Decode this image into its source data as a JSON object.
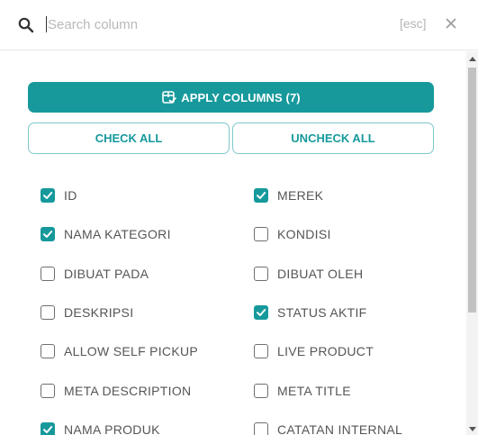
{
  "search": {
    "placeholder": "Search column",
    "esc_hint": "[esc]"
  },
  "actions": {
    "apply_label": "APPLY COLUMNS (7)",
    "check_all_label": "CHECK ALL",
    "uncheck_all_label": "UNCHECK ALL"
  },
  "columns": [
    {
      "label": "ID",
      "checked": true
    },
    {
      "label": "MEREK",
      "checked": true
    },
    {
      "label": "NAMA KATEGORI",
      "checked": true
    },
    {
      "label": "KONDISI",
      "checked": false
    },
    {
      "label": "DIBUAT PADA",
      "checked": false
    },
    {
      "label": "DIBUAT OLEH",
      "checked": false
    },
    {
      "label": "DESKRIPSI",
      "checked": false
    },
    {
      "label": "STATUS AKTIF",
      "checked": true
    },
    {
      "label": "ALLOW SELF PICKUP",
      "checked": false
    },
    {
      "label": "LIVE PRODUCT",
      "checked": false
    },
    {
      "label": "META DESCRIPTION",
      "checked": false
    },
    {
      "label": "META TITLE",
      "checked": false
    },
    {
      "label": "NAMA PRODUK",
      "checked": true
    },
    {
      "label": "CATATAN INTERNAL",
      "checked": false
    }
  ],
  "icons": {
    "search": "search-icon",
    "close": "close-icon",
    "apply": "column-apply-icon",
    "checkbox": "checkmark-icon"
  },
  "colors": {
    "accent": "#17999c",
    "accent_border": "#7ec8ca"
  }
}
